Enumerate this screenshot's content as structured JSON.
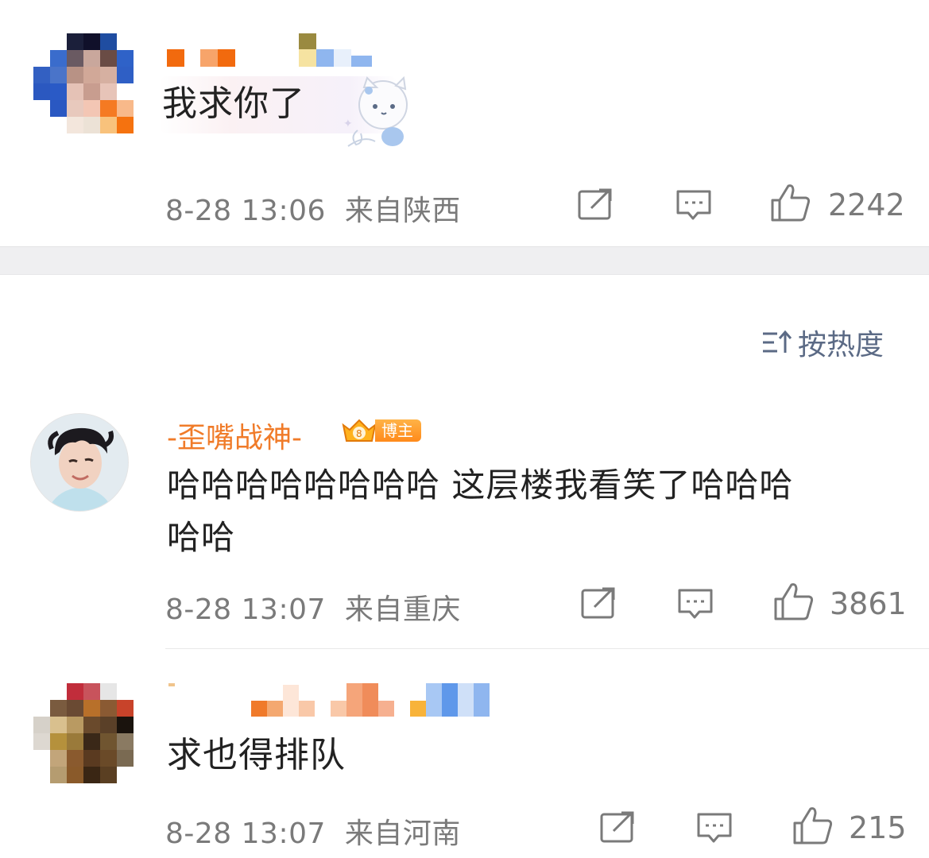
{
  "comments": [
    {
      "text": "我求你了",
      "time": "8-28 13:06",
      "location": "来自陕西",
      "likes": "2242",
      "sticker": "cat-sticker"
    },
    {
      "author": "-歪嘴战神-",
      "badge": "博主",
      "text_line1": "哈哈哈哈哈哈哈哈 这层楼我看笑了哈哈哈",
      "text_line2": "哈哈",
      "time": "8-28 13:07",
      "location": "来自重庆",
      "likes": "3861"
    },
    {
      "text": "求也得排队",
      "time": "8-28 13:07",
      "location": "来自河南",
      "likes": "215"
    }
  ],
  "sort": {
    "label": "按热度",
    "icon": "sort-icon"
  },
  "colors": {
    "accent_orange": "#f07b29",
    "link_gray_blue": "#5b6a85",
    "meta_gray": "#7a7a7a",
    "divider": "#efeff1"
  },
  "icons": [
    "repost-icon",
    "comment-icon",
    "like-icon",
    "sort-icon",
    "crown-icon"
  ]
}
